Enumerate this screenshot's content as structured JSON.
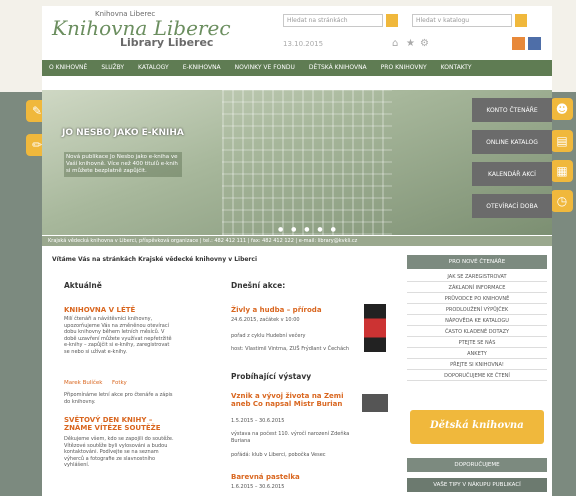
{
  "logo": {
    "top_line": "Knihovna Liberec",
    "main": "Knihovna Liberec",
    "sub": "Library Liberec"
  },
  "header": {
    "search1_placeholder": "Hledat na stránkách",
    "search2_placeholder": "Hledat v katalogu",
    "date": "13.10.2015"
  },
  "nav": {
    "items": [
      "O knihovně",
      "Služby",
      "Katalogy",
      "E-knihovna",
      "Novinky ve fondu",
      "Dětská knihovna",
      "Pro knihovny",
      "Kontakty"
    ]
  },
  "hero": {
    "title": "JO NESBO JAKO E-KNIHA",
    "text": "Nová publikace Jo Nesbo jako e-kniha ve Vaší knihovně. Více než 400 titulů e-knih si můžete bezplatně zapůjčit.",
    "buttons": [
      "Konto čtenáře",
      "Online katalog",
      "Kalendář akcí",
      "Otevírací doba"
    ],
    "dots": "● ● ● ● ●"
  },
  "infobar": "Krajská vědecká knihovna v Liberci, příspěvková organizace | tel.: 482 412 111 | fax: 482 412 122 | e-mail: library@kvkli.cz",
  "welcome": "Vítáme Vás na stránkách Krajské vědecké knihovny v Liberci",
  "aktualne": {
    "heading": "Aktuálně",
    "article1": {
      "title": "KNIHOVNA V LÉTĚ",
      "text": "Milí čtenáři a návštěvníci knihovny, upozorňujeme Vás na změněnou otevírací dobu knihovny během letních měsíců. V době uzavření můžete využívat nepřetržitě e-knihy – zapůjčit si e-knihy, zaregistrovat se nebo si užívat e-knihy.",
      "link1": "Marek Bulíček",
      "link2": "Fotky",
      "text2": "Připomínáme letní akce pro čtenáře a zápis do knihovny."
    },
    "article2": {
      "title": "SVĚTOVÝ DEN KNIHY – ZNÁME VÍTĚZE SOUTĚŽE",
      "text": "Děkujeme všem, kdo se zapojili do soutěže. Vítězové soutěže byli vylosováni a budou kontaktováni. Podívejte se na seznam výherců a fotografie ze slavnostního vyhlášení."
    }
  },
  "akce": {
    "heading": "Dnešní akce:",
    "item1": {
      "title": "Živly a hudba – příroda",
      "date": "24.6.2015, začátek v 10:00",
      "text": "pořad z cyklu Hudební večery",
      "place": "host: Vlastimil Vintrna, ZUŠ Frýdlant v Čechách"
    }
  },
  "vystavy": {
    "heading": "Probíhající výstavy",
    "item1": {
      "title": "Vznik a vývoj života na Zemi aneb Co napsal Mistr Burian",
      "date": "1.5.2015 – 30.6.2015",
      "text": "výstava na počest 110. výročí narození Zdeňka Buriana",
      "place": "pořádá: klub v Liberci, pobočka Vesec"
    },
    "item2": {
      "title": "Barevná pastelka",
      "date": "1.6.2015 – 30.6.2015"
    }
  },
  "right": {
    "heading": "Pro nové čtenáře",
    "links": [
      "Jak se zaregistrovat",
      "Základní informace",
      "Průvodce po knihovně",
      "Prodloužení výpůjček",
      "Nápověda ke katalogu",
      "Často kladené dotazy",
      "Ptejte se nás",
      "Ankety",
      "Přejte si knihovna!",
      "Doporučujeme ke čtení"
    ],
    "banner": "Dětská knihovna",
    "heading2": "Doporučujeme",
    "heading3": "Vaše tipy v nákupu publikací"
  },
  "colors": {
    "nav": "#5f7c53",
    "accent": "#d9661f",
    "side": "#7c8a7f",
    "yellow": "#f0b83c"
  }
}
